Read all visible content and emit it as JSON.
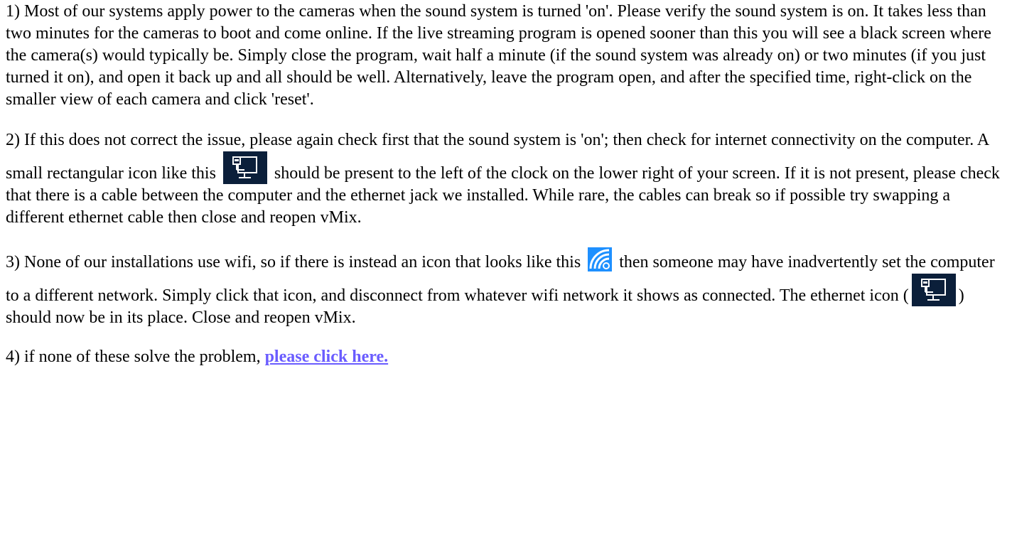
{
  "paragraphs": {
    "p1": "1) Most of our systems apply power to the cameras when the sound system is turned 'on'. Please verify the sound system is on. It takes less than two minutes for the cameras to boot and come online. If the live streaming program is opened sooner than this you will see a black screen where the camera(s) would typically be. Simply close the program, wait half a minute (if the sound system was already on) or two minutes (if you just turned it on), and open it back up and all should be well. Alternatively, leave the program open, and after the specified time, right-click on the smaller view of each camera and click 'reset'.",
    "p2_before_icon": "2) If this does not correct the issue, please again check first that the sound system is 'on'; then check for internet connectivity on the computer. A small rectangular icon like this",
    "p2_after_icon": "should be present to the left of the clock on the lower right of your screen. If it is not present, please check that there is a cable between the computer and the ethernet jack we installed. While rare, the cables can break so if possible try swapping a different ethernet cable then close and reopen vMix.",
    "p3_before_wifi": "3) None of our installations use wifi, so if there is instead an icon that looks like this",
    "p3_after_wifi": "then someone may have inadvertently set the computer to a different network. Simply click that icon, and disconnect from whatever wifi network it shows as connected. The ethernet icon (",
    "p3_after_eth": ") should now be in its place. Close and reopen vMix.",
    "p4_before_link": "4) if none of these solve the problem,",
    "p4_link": "please click here."
  },
  "icons": {
    "ethernet": "ethernet-icon",
    "wifi": "wifi-icon"
  },
  "colors": {
    "link": "#6a5cff",
    "ethernet_bg": "#0b1f3a",
    "wifi_bg": "#1e90ff"
  }
}
